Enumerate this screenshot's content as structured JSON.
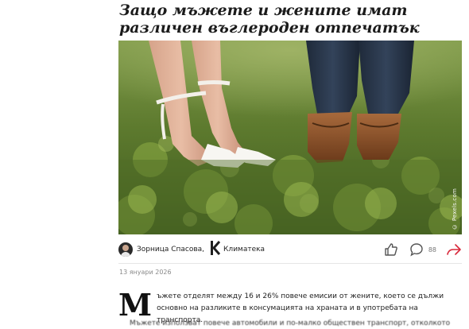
{
  "article": {
    "headline": "Защо мъжете и жените имат различен въглероден отпечатък",
    "photo_credit": "© Pexels.com",
    "author": "Зорница Спасова,",
    "section": "Климатека",
    "comment_count": "88",
    "date": "13 януари 2026",
    "dropcap": "М",
    "lead": "ъжете отделят между 16 и 26% повече емисии от жените, което се дължи основно на разликите в консумацията на храната и в употребата на транспорта.",
    "next_paragraph_fragment": "Мъжете използват повече автомобили и по-малко обществен транспорт, отколкото жените"
  },
  "icons": {
    "section": "klimateka-logo-icon",
    "like": "thumbs-up-icon",
    "comments": "comment-bubble-icon",
    "share": "share-arrow-icon"
  },
  "colors": {
    "share_accent": "#d8283a",
    "text": "#1f1f1f",
    "muted": "#8a8a8a"
  }
}
